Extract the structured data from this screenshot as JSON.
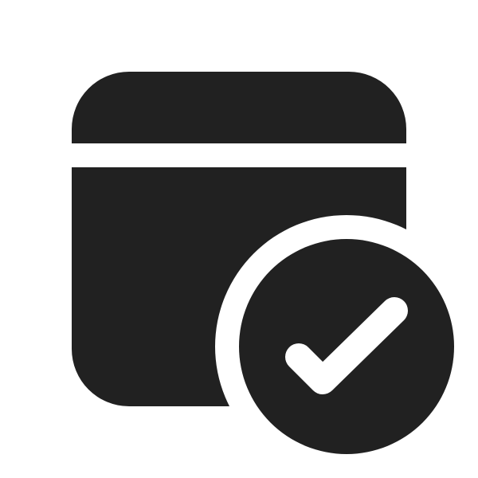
{
  "icon": {
    "name": "calendar-checkmark-icon",
    "parts": [
      "calendar-header",
      "calendar-body",
      "check-badge",
      "checkmark"
    ]
  },
  "colors": {
    "background": "#ffffff",
    "fill": "#212121",
    "accent": "#ffffff"
  }
}
